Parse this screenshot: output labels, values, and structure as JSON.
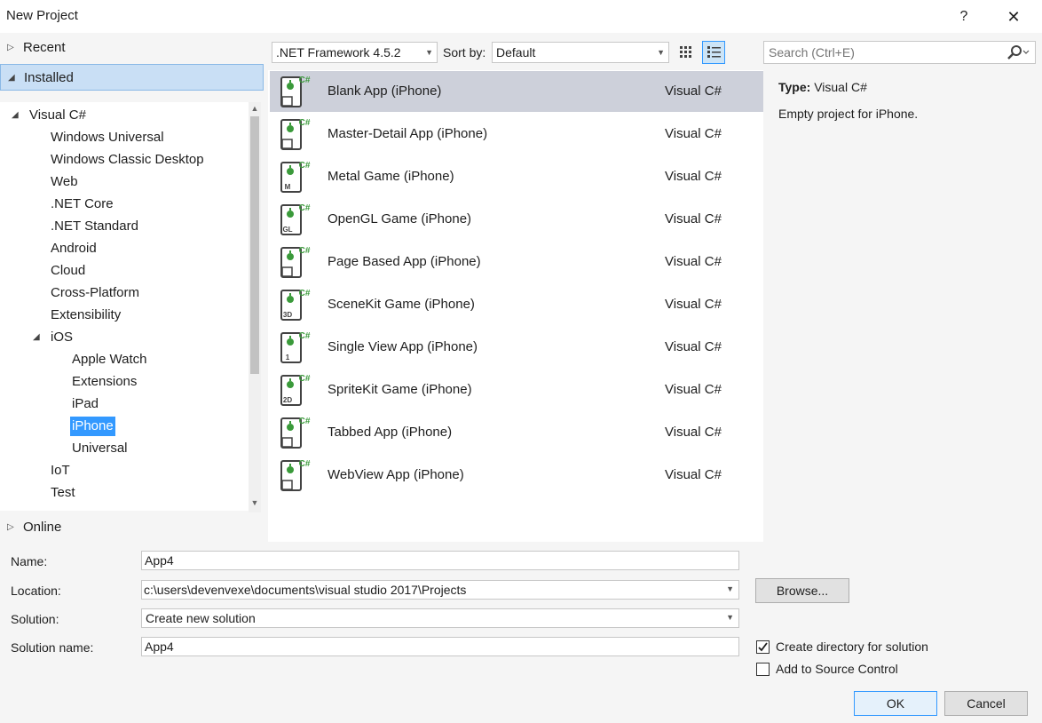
{
  "window": {
    "title": "New Project",
    "help_label": "?",
    "close_label": "✕"
  },
  "nav": {
    "recent": "Recent",
    "installed": "Installed",
    "online": "Online",
    "tree": [
      {
        "label": "Visual C#",
        "level": 0,
        "expanded": true
      },
      {
        "label": "Windows Universal",
        "level": 1
      },
      {
        "label": "Windows Classic Desktop",
        "level": 1
      },
      {
        "label": "Web",
        "level": 1
      },
      {
        "label": ".NET Core",
        "level": 1
      },
      {
        "label": ".NET Standard",
        "level": 1
      },
      {
        "label": "Android",
        "level": 1
      },
      {
        "label": "Cloud",
        "level": 1
      },
      {
        "label": "Cross-Platform",
        "level": 1
      },
      {
        "label": "Extensibility",
        "level": 1
      },
      {
        "label": "iOS",
        "level": 1,
        "expanded": true
      },
      {
        "label": "Apple Watch",
        "level": 2
      },
      {
        "label": "Extensions",
        "level": 2
      },
      {
        "label": "iPad",
        "level": 2
      },
      {
        "label": "iPhone",
        "level": 2,
        "selected": true
      },
      {
        "label": "Universal",
        "level": 2
      },
      {
        "label": "IoT",
        "level": 1
      },
      {
        "label": "Test",
        "level": 1
      }
    ]
  },
  "toolbar": {
    "framework": ".NET Framework 4.5.2",
    "sort_label": "Sort by:",
    "sort_value": "Default",
    "search_placeholder": "Search (Ctrl+E)"
  },
  "templates": [
    {
      "name": "Blank App (iPhone)",
      "lang": "Visual C#",
      "badge": "",
      "selected": true
    },
    {
      "name": "Master-Detail App (iPhone)",
      "lang": "Visual C#",
      "badge": ""
    },
    {
      "name": "Metal Game (iPhone)",
      "lang": "Visual C#",
      "badge": "M"
    },
    {
      "name": "OpenGL Game (iPhone)",
      "lang": "Visual C#",
      "badge": "GL"
    },
    {
      "name": "Page Based App (iPhone)",
      "lang": "Visual C#",
      "badge": ""
    },
    {
      "name": "SceneKit Game (iPhone)",
      "lang": "Visual C#",
      "badge": "3D"
    },
    {
      "name": "Single View App (iPhone)",
      "lang": "Visual C#",
      "badge": "1"
    },
    {
      "name": "SpriteKit Game (iPhone)",
      "lang": "Visual C#",
      "badge": "2D"
    },
    {
      "name": "Tabbed App (iPhone)",
      "lang": "Visual C#",
      "badge": ""
    },
    {
      "name": "WebView App (iPhone)",
      "lang": "Visual C#",
      "badge": ""
    }
  ],
  "details": {
    "type_label": "Type:",
    "type_value": "Visual C#",
    "description": "Empty project for iPhone."
  },
  "form": {
    "name_label": "Name:",
    "name_value": "App4",
    "location_label": "Location:",
    "location_value": "c:\\users\\devenvexe\\documents\\visual studio 2017\\Projects",
    "browse_label": "Browse...",
    "solution_label": "Solution:",
    "solution_value": "Create new solution",
    "solution_name_label": "Solution name:",
    "solution_name_value": "App4",
    "create_dir_label": "Create directory for solution",
    "create_dir_checked": true,
    "source_control_label": "Add to Source Control",
    "source_control_checked": false,
    "ok_label": "OK",
    "cancel_label": "Cancel"
  },
  "colors": {
    "accent": "#3399ff",
    "icon_green": "#3a9a3a",
    "icon_dark": "#424242"
  }
}
